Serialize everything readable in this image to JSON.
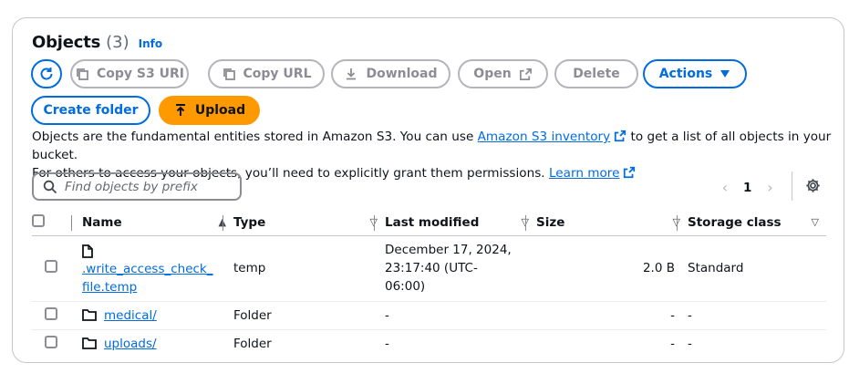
{
  "header": {
    "title": "Objects",
    "count": "(3)",
    "info": "Info"
  },
  "toolbar": {
    "copy_s3_uri": "Copy S3 URI",
    "copy_url": "Copy URL",
    "download": "Download",
    "open": "Open",
    "delete": "Delete",
    "actions": "Actions",
    "create_folder": "Create folder",
    "upload": "Upload"
  },
  "description": {
    "part1": "Objects are the fundamental entities stored in Amazon S3. You can use ",
    "link1": "Amazon S3 inventory",
    "part2": " to get a list of all objects in your bucket.",
    "part3": "For others to access your objects, you’ll need to explicitly grant them permissions. ",
    "link2": "Learn more"
  },
  "search": {
    "placeholder": "Find objects by prefix"
  },
  "pagination": {
    "page": "1"
  },
  "table": {
    "columns": [
      "Name",
      "Type",
      "Last modified",
      "Size",
      "Storage class"
    ],
    "rows": [
      {
        "name_line1": ".write_access_check_",
        "name_line2": "file.temp",
        "type": "temp",
        "modified_line1": "December 17, 2024,",
        "modified_line2": "23:17:40 (UTC-",
        "modified_line3": "06:00)",
        "size": "2.0 B",
        "storage": "Standard",
        "icon": "file-icon"
      },
      {
        "name": "medical/",
        "type": "Folder",
        "modified": "-",
        "size": "-",
        "storage": "-",
        "icon": "folder-icon"
      },
      {
        "name": "uploads/",
        "type": "Folder",
        "modified": "-",
        "size": "-",
        "storage": "-",
        "icon": "folder-icon"
      }
    ]
  },
  "colors": {
    "accent": "#006ce0",
    "upload": "#ff9900",
    "disabled": "#8c8c94"
  }
}
